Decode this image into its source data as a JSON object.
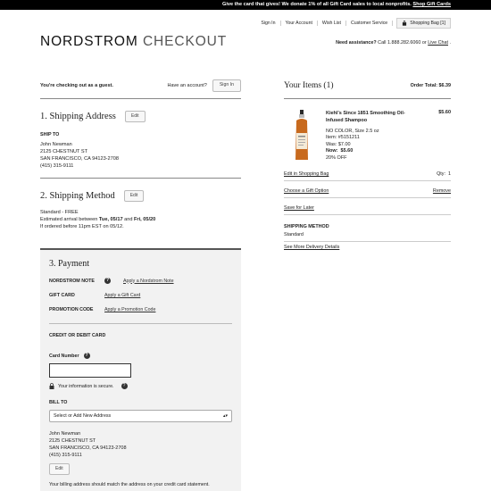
{
  "promo": {
    "text": "Give the card that gives! We donate 1% of all Gift Card sales to local nonprofits. ",
    "link": "Shop Gift Cards"
  },
  "utility_nav": [
    "Sign In",
    "Your Account",
    "Wish List",
    "Customer Service"
  ],
  "shopping_bag": "Shopping Bag [1]",
  "logo": {
    "brand": "NORDSTROM",
    "section": "CHECKOUT"
  },
  "assistance": {
    "label": "Need assistance?",
    "text": "Call 1.888.282.6060 or",
    "chat": "Live Chat"
  },
  "guest": {
    "message": "You're checking out as a guest.",
    "account_question": "Have an account?",
    "sign_in": "Sign In"
  },
  "shipping_address": {
    "title": "1. Shipping Address",
    "edit": "Edit",
    "ship_to_label": "SHIP TO",
    "lines": [
      "John Newman",
      "2125 CHESTNUT ST",
      "SAN FRANCISCO, CA  94123-2708",
      "(415) 315-9111"
    ]
  },
  "shipping_method": {
    "title": "2. Shipping Method",
    "edit": "Edit",
    "line1": "Standard - FREE",
    "line2_pre": "Estimated arrival between ",
    "line2_d1": "Tue, 05/17",
    "line2_mid": " and ",
    "line2_d2": "Fri, 05/20",
    "line3": "If ordered before 11pm EST on 05/12."
  },
  "payment": {
    "title": "3. Payment",
    "nordstrom_note_label": "NORDSTROM NOTE",
    "nordstrom_note_link": "Apply a Nordstrom Note",
    "gift_card_label": "GIFT CARD",
    "gift_card_link": "Apply a Gift Card",
    "promo_label": "PROMOTION CODE",
    "promo_link": "Apply a Promotion Code",
    "credit_title": "CREDIT OR DEBIT CARD",
    "card_number_label": "Card Number",
    "card_number_value": "",
    "secure_text": "Your information is secure.",
    "bill_to_label": "BILL TO",
    "bill_select": "Select or Add New Address",
    "bill_lines": [
      "John Newman",
      "2125 CHESTNUT ST",
      "SAN FRANCISCO, CA  94123-2708",
      "(415) 315-9111"
    ],
    "edit": "Edit",
    "note": "Your billing address should match the address on your credit card statement."
  },
  "order": {
    "title": "Your Items (1)",
    "total": "Order Total: $6.39",
    "product": {
      "name": "Kiehl's Since 1851 Smoothing Oil-Infused Shampoo",
      "price": "$5.60",
      "color_size": "NO COLOR, Size 2.5 oz",
      "item": "Item:  #5151211",
      "was": "Was:  $7.00",
      "now_label": "Now:",
      "now_value": "$5.60",
      "discount": "20% OFF"
    },
    "edit_bag": "Edit in Shopping Bag",
    "qty": "Qty:",
    "qty_value": "1",
    "gift_option": "Choose a Gift Option",
    "remove": "Remove",
    "save_later": "Save for Later",
    "shipping_method_label": "SHIPPING METHOD",
    "shipping_method_value": "Standard",
    "more_options": "See More Delivery Details"
  }
}
